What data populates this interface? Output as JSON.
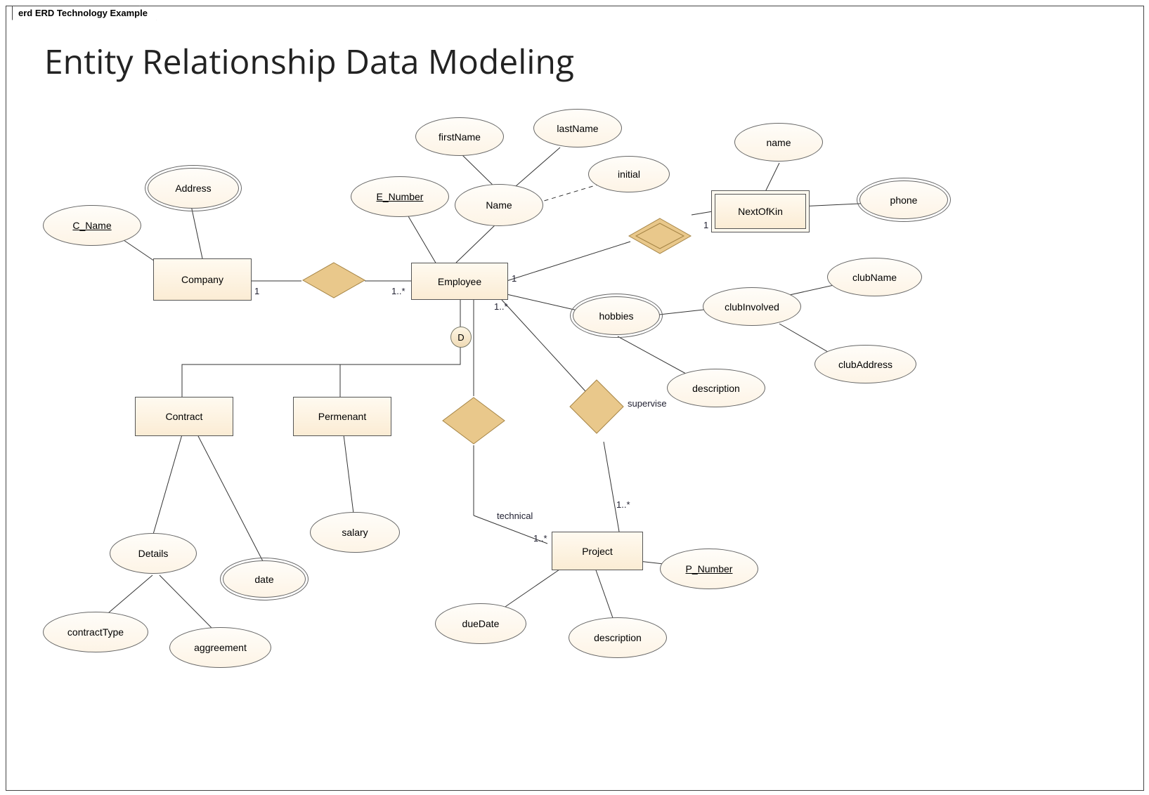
{
  "tab_label": "erd ERD Technology Example",
  "title": "Entity Relationship Data Modeling",
  "entities": {
    "company": "Company",
    "employee": "Employee",
    "contract": "Contract",
    "permanent": "Permenant",
    "project": "Project",
    "nextofkin": "NextOfKin"
  },
  "attributes": {
    "c_name": "C_Name",
    "address": "Address",
    "e_number": "E_Number",
    "name": "Name",
    "firstname": "firstName",
    "lastname": "lastName",
    "initial": "initial",
    "nok_name": "name",
    "nok_phone": "phone",
    "hobbies": "hobbies",
    "club_involved": "clubInvolved",
    "club_name": "clubName",
    "club_address": "clubAddress",
    "hobbies_desc": "description",
    "details": "Details",
    "contract_type": "contractType",
    "aggreement": "aggreement",
    "date": "date",
    "salary": "salary",
    "p_number": "P_Number",
    "due_date": "dueDate",
    "proj_desc": "description"
  },
  "relationship_labels": {
    "supervise": "supervise",
    "technical": "technical",
    "disjoint": "D"
  },
  "cardinalities": {
    "company_employee_left": "1",
    "company_employee_right": "1..*",
    "employee_nextofkin_left": "1",
    "employee_nextofkin_right": "1",
    "employee_project_topA": "1..*",
    "supervise_project": "1..*",
    "technical_project": "1..*"
  }
}
